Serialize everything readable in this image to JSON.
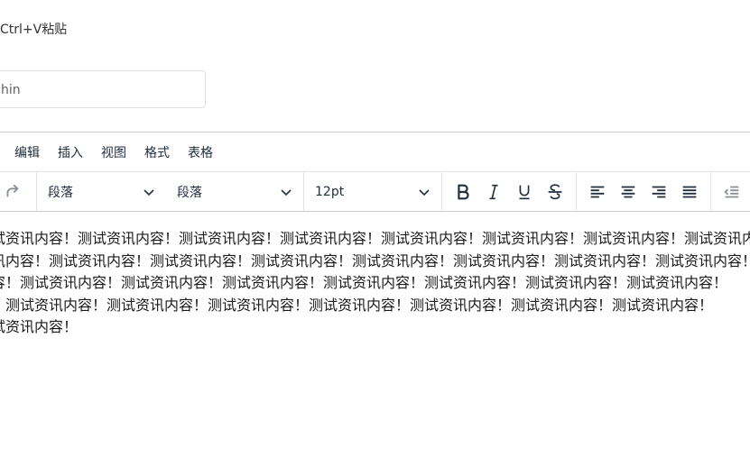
{
  "hint": "Ctrl+V粘贴",
  "author_field": {
    "value": "hin"
  },
  "menubar": {
    "items": [
      "编辑",
      "插入",
      "视图",
      "格式",
      "表格"
    ]
  },
  "toolbar": {
    "block_format": "段落",
    "font_family": "段落",
    "font_size": "12pt",
    "icons": [
      "redo-icon",
      "bold-icon",
      "italic-icon",
      "underline-icon",
      "strikethrough-icon",
      "align-left-icon",
      "align-center-icon",
      "align-right-icon",
      "align-justify-icon",
      "outdent-icon"
    ]
  },
  "content": {
    "lines": [
      "试资讯内容！测试资讯内容！测试资讯内容！测试资讯内容！测试资讯内容！测试资讯内容！测试资讯内容！测试资讯内容！",
      "讯内容！测试资讯内容！测试资讯内容！测试资讯内容！测试资讯内容！测试资讯内容！测试资讯内容！测试资讯内容！",
      "容！测试资讯内容！测试资讯内容！测试资讯内容！测试资讯内容！测试资讯内容！测试资讯内容！测试资讯内容！",
      "！测试资讯内容！测试资讯内容！测试资讯内容！测试资讯内容！测试资讯内容！测试资讯内容！测试资讯内容！",
      "试资讯内容！"
    ]
  }
}
